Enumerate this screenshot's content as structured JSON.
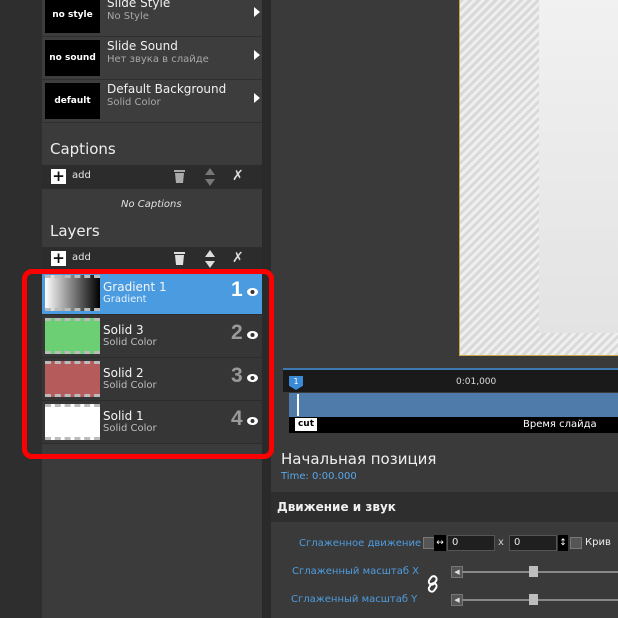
{
  "slide_props": [
    {
      "thumb": "no style",
      "title": "Slide Style",
      "subtitle": "No Style"
    },
    {
      "thumb": "no sound",
      "title": "Slide Sound",
      "subtitle": "Нет звука в слайде"
    },
    {
      "thumb": "default",
      "title": "Default Background",
      "subtitle": "Solid Color"
    }
  ],
  "captions": {
    "title": "Captions",
    "add_label": "add",
    "empty_text": "No Captions"
  },
  "layers": {
    "title": "Layers",
    "add_label": "add",
    "items": [
      {
        "name": "Gradient 1",
        "type": "Gradient",
        "number": "1",
        "selected": true
      },
      {
        "name": "Solid 3",
        "type": "Solid Color",
        "number": "2",
        "color": "#6ccf74"
      },
      {
        "name": "Solid 2",
        "type": "Solid Color",
        "number": "3",
        "color": "#b65b5b"
      },
      {
        "name": "Solid 1",
        "type": "Solid Color",
        "number": "4",
        "color": "#ffffff"
      }
    ]
  },
  "timeline": {
    "marker": "1",
    "time_label": "0:01,000",
    "cut_label": "cut",
    "track_label": "Время слайда"
  },
  "position": {
    "title": "Начальная позиция",
    "time": "Time: 0:00.000"
  },
  "motion": {
    "title": "Движение и звук",
    "smooth_motion_label": "Сглаженное движение",
    "x_value": "0",
    "x_sep": "x",
    "y_value": "0",
    "curves_label": "Крив",
    "scale_x_label": "Сглаженный масштаб X",
    "scale_y_label": "Сглаженный масштаб Y"
  },
  "colors": {
    "selected": "#4a9be0",
    "highlight": "#ff0000",
    "accent_text": "#4f9de0"
  }
}
